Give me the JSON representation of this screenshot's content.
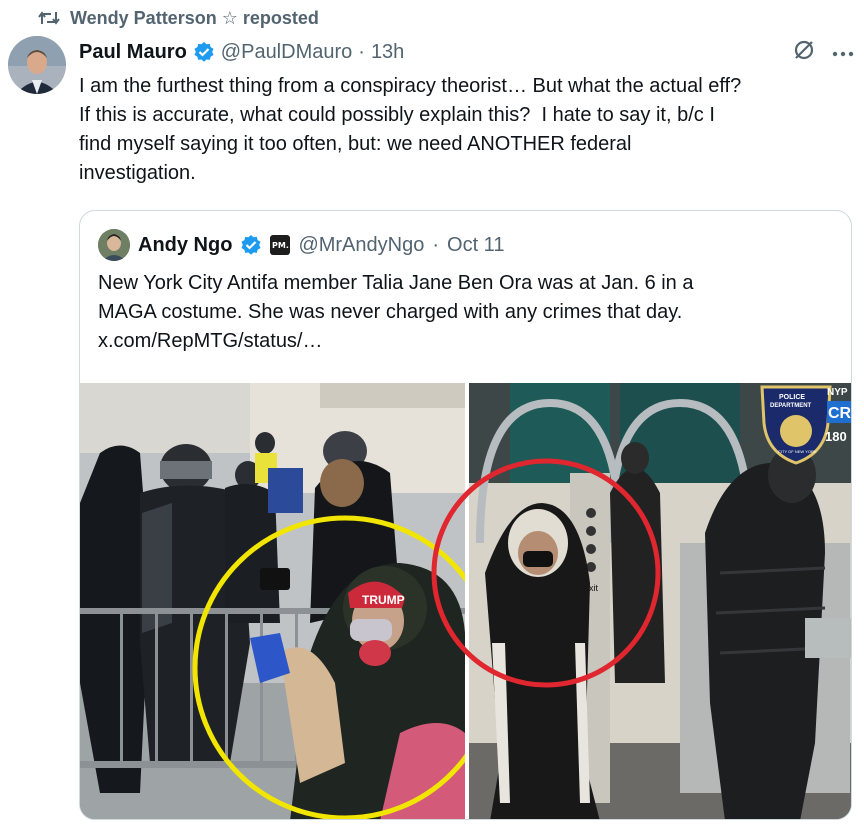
{
  "repost": {
    "text": "Wendy Patterson ☆ reposted",
    "icon": "repost-icon"
  },
  "post": {
    "author_name": "Paul Mauro",
    "handle": "@PaulDMauro",
    "separator": "·",
    "time": "13h",
    "text": "I am the furthest thing from a conspiracy theorist… But what the actual eff?\nIf this is accurate, what could possibly explain this?  I hate to say it, b/c I\nfind myself saying it too often, but: we need ANOTHER federal\ninvestigation."
  },
  "quoted": {
    "author_name": "Andy Ngo",
    "affiliate_badge": "PM.",
    "handle": "@MrAndyNgo",
    "separator": "·",
    "time": "Oct 11",
    "text": "New York City Antifa member Talia Jane Ben Ora was at Jan. 6 in a\nMAGA costume. She was never charged with any crimes that day.\nx.com/RepMTG/status/…"
  },
  "media": {
    "hat_text": "TRUMP",
    "police_patch_top": "POLICE",
    "police_patch_mid": "DEPARTMENT",
    "police_patch_ring": "CITY OF NEW YORK",
    "corner_label_1": "NYP",
    "corner_label_2": "CR",
    "corner_label_3": "180",
    "sign_text": "Exit",
    "highlight_colors": {
      "left": "#f2e600",
      "right": "#e0262e"
    }
  },
  "colors": {
    "verified": "#1d9bf0",
    "text_secondary": "#536471",
    "border": "#cfd9de"
  }
}
